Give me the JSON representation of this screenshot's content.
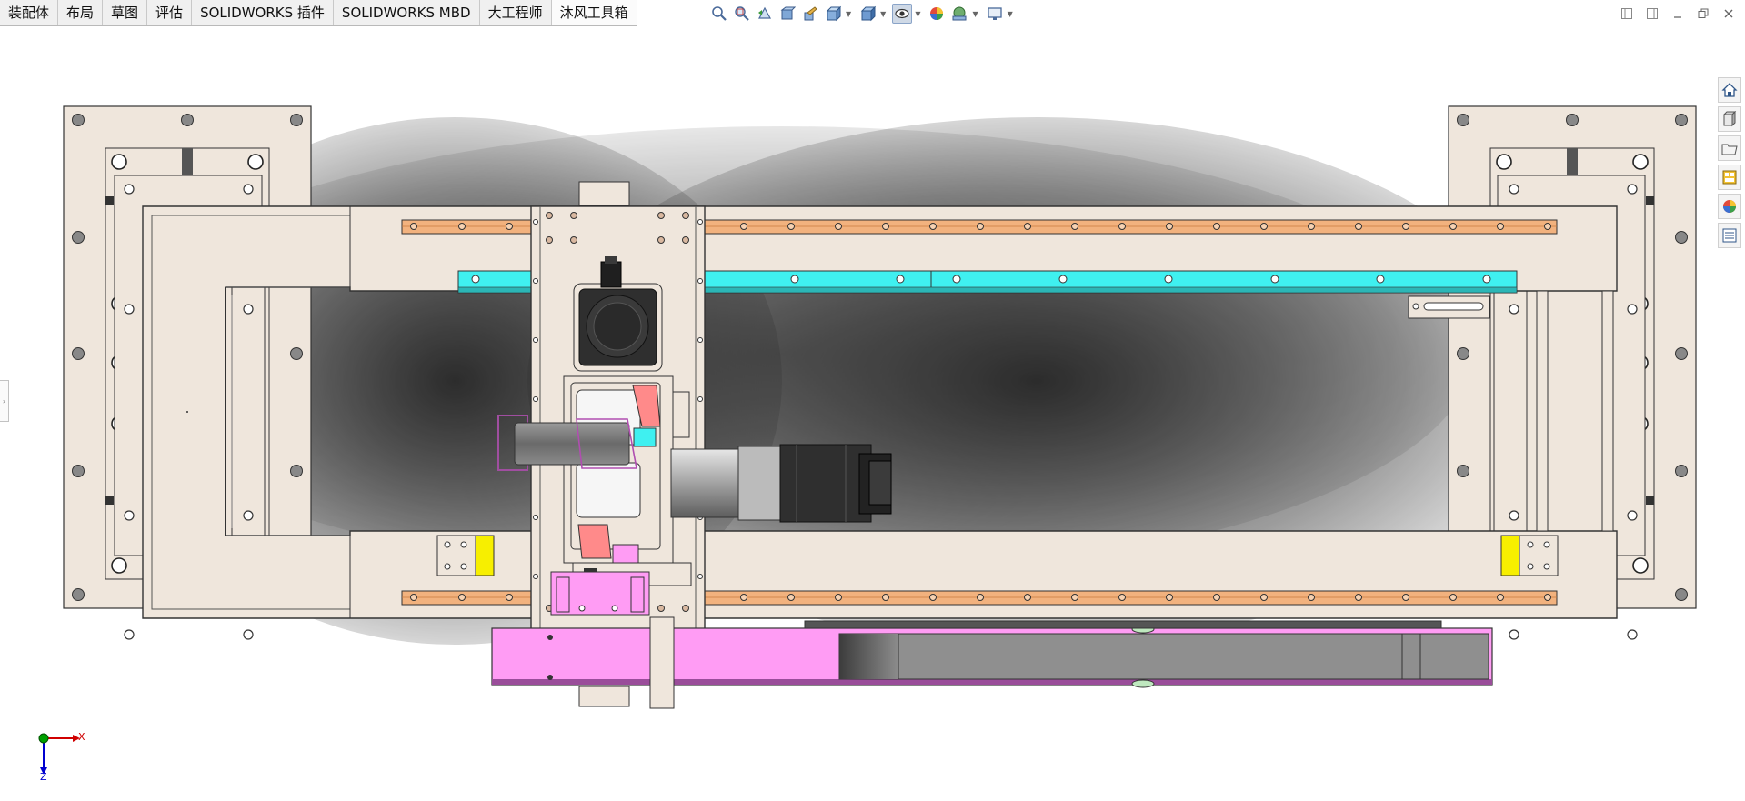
{
  "command_manager": {
    "tabs": [
      {
        "label": "装配体"
      },
      {
        "label": "布局"
      },
      {
        "label": "草图"
      },
      {
        "label": "评估"
      },
      {
        "label": "SOLIDWORKS 插件"
      },
      {
        "label": "SOLIDWORKS MBD"
      },
      {
        "label": "大工程师"
      },
      {
        "label": "沐风工具箱"
      }
    ],
    "active_tab": "沐风工具箱"
  },
  "heads_up_toolbar": {
    "icons": [
      "zoom-to-fit-icon",
      "zoom-to-area-icon",
      "previous-view-icon",
      "section-view-icon",
      "dynamic-annotation-icon",
      "view-orientation-icon",
      "display-style-icon",
      "hide-show-items-icon",
      "edit-appearance-icon",
      "apply-scene-icon",
      "view-settings-icon"
    ]
  },
  "window_controls": {
    "icons": [
      "restore-panel-left-icon",
      "restore-panel-right-icon",
      "minimize-icon",
      "restore-icon",
      "close-icon"
    ]
  },
  "task_pane": {
    "icons": [
      "solidworks-resources-icon",
      "design-library-icon",
      "file-explorer-icon",
      "view-palette-icon",
      "appearances-icon",
      "custom-properties-icon"
    ]
  },
  "triad": {
    "x_label": "X",
    "z_label": "Z"
  },
  "colors": {
    "frame": "#efe6dc",
    "rail": "#f2b27e",
    "rack": "#3ff0f0",
    "magenta": "#ff9cf4",
    "motor": "#333333",
    "x_axis": "#d00000",
    "z_axis": "#0000d0",
    "origin": "#00a000"
  }
}
